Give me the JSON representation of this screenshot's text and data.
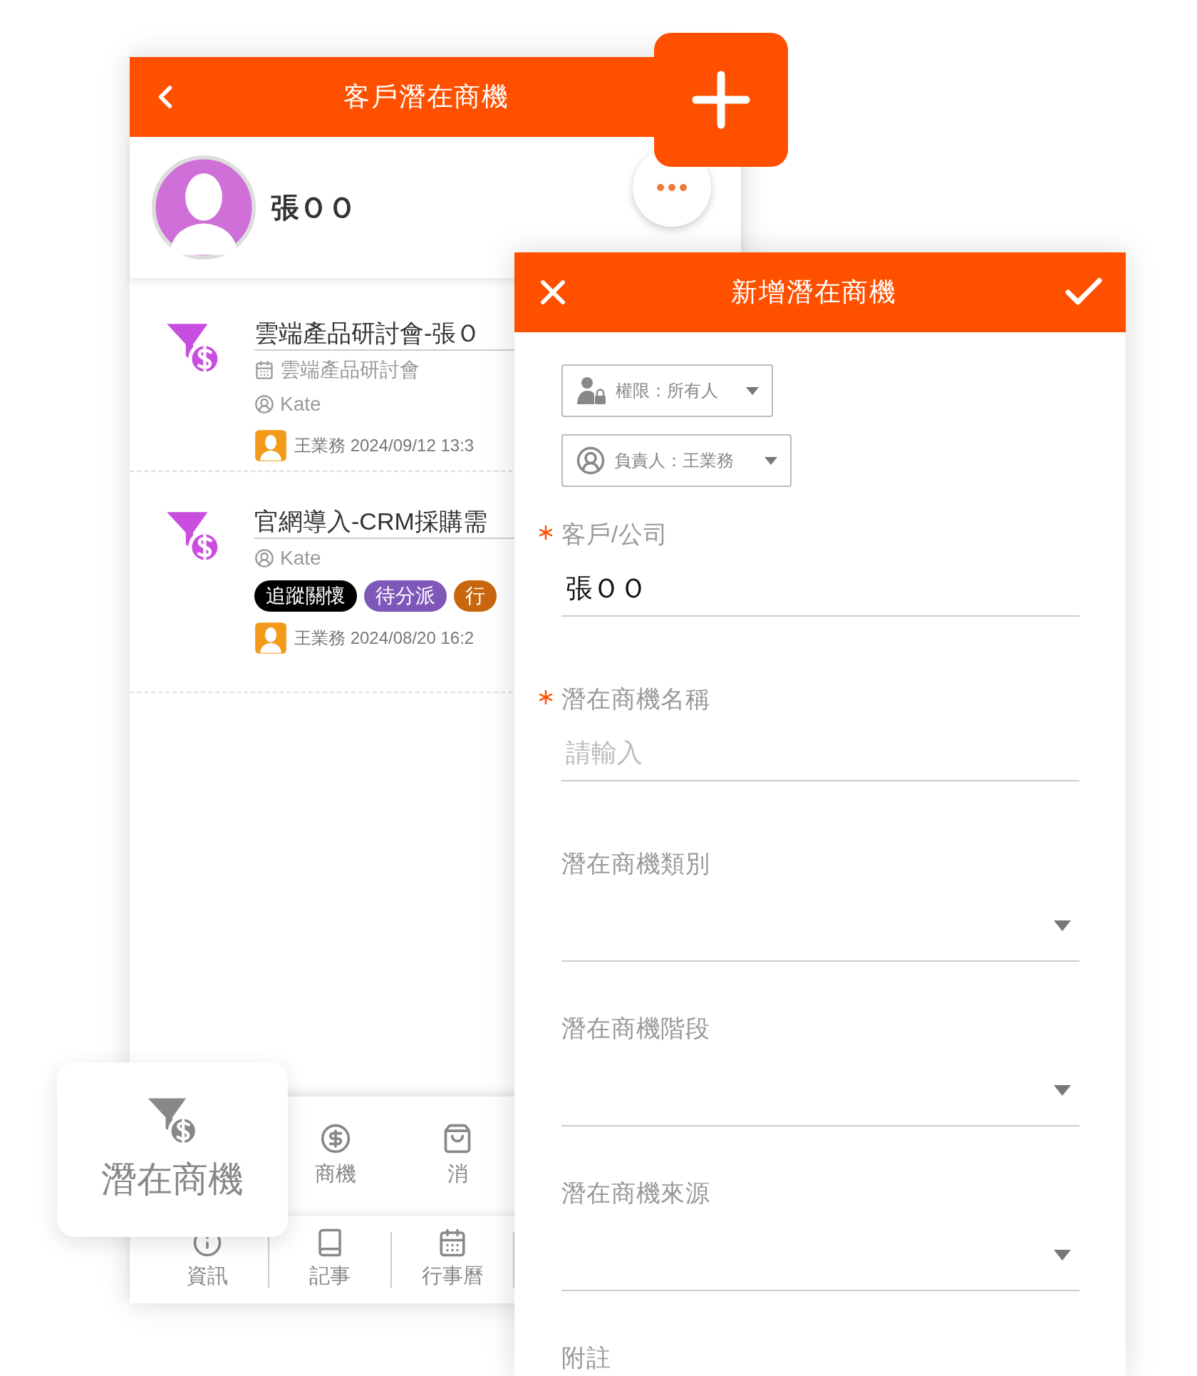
{
  "customer_screen": {
    "title": "客戶潛在商機",
    "customer_name": "張ＯＯ",
    "opportunities": [
      {
        "title": "雲端產品研討會-張Ｏ",
        "event": "雲端產品研討會",
        "contact": "Kate",
        "owner_line": "王業務 2024/09/12 13:3"
      },
      {
        "title": "官網導入-CRM採購需",
        "contact": "Kate",
        "tags": [
          {
            "label": "追蹤關懷",
            "color": "#000000"
          },
          {
            "label": "待分派",
            "color": "#7e57b8"
          },
          {
            "label": "行",
            "color": "#c8660e"
          }
        ],
        "owner_line": "王業務 2024/08/20 16:2"
      }
    ],
    "nav_top": [
      {
        "label": "商機"
      },
      {
        "label": "消"
      }
    ],
    "nav_bottom": [
      {
        "label": "資訊"
      },
      {
        "label": "記事"
      },
      {
        "label": "行事曆"
      }
    ]
  },
  "floating_tab": {
    "label": "潛在商機"
  },
  "form": {
    "title": "新增潛在商機",
    "permission": "權限：所有人",
    "owner": "負責人：王業務",
    "fields": [
      {
        "kind": "text",
        "label": "客戶/公司",
        "required": true,
        "value": "張ＯＯ"
      },
      {
        "kind": "text",
        "label": "潛在商機名稱",
        "required": true,
        "placeholder": "請輸入"
      },
      {
        "kind": "select",
        "label": "潛在商機類別",
        "required": false
      },
      {
        "kind": "select",
        "label": "潛在商機階段",
        "required": false
      },
      {
        "kind": "select",
        "label": "潛在商機來源",
        "required": false
      },
      {
        "kind": "note",
        "label": "附註",
        "required": false
      }
    ]
  }
}
